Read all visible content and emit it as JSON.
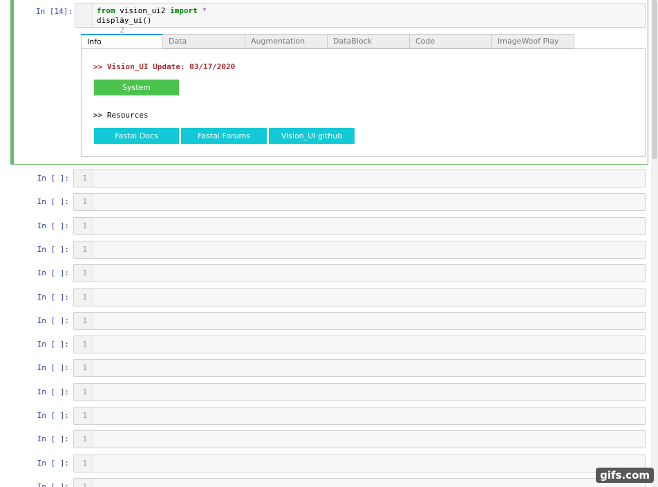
{
  "active_cell": {
    "prompt": "In [14]:",
    "lines": [
      {
        "number": "1",
        "keyword_from": "from",
        "module": " vision_ui2 ",
        "keyword_import": "import",
        "star": " *"
      },
      {
        "number": "2",
        "text": "display_ui()"
      }
    ]
  },
  "widget": {
    "tabs": [
      {
        "label": "Info",
        "selected": true
      },
      {
        "label": "Data",
        "selected": false
      },
      {
        "label": "Augmentation",
        "selected": false
      },
      {
        "label": "DataBlock",
        "selected": false
      },
      {
        "label": "Code",
        "selected": false
      },
      {
        "label": "ImageWoof Play",
        "selected": false
      }
    ],
    "update_text": ">> Vision_UI Update: 03/17/2020",
    "system_button": "System",
    "resources_text": ">> Resources",
    "resource_buttons": [
      "Fastai Docs",
      "Fastai Forums",
      "Vision_UI github"
    ]
  },
  "empty_cells": {
    "prompt": "In [ ]:",
    "line_number": "1",
    "count": 14
  },
  "colors": {
    "active_border": "#66bb6a",
    "prompt": "#303f9f",
    "system_button": "#4cc34f",
    "resource_button": "#13c9d6",
    "update_text": "#a52a2a",
    "tab_accent": "#2196f3"
  },
  "watermark": "gifs.com"
}
